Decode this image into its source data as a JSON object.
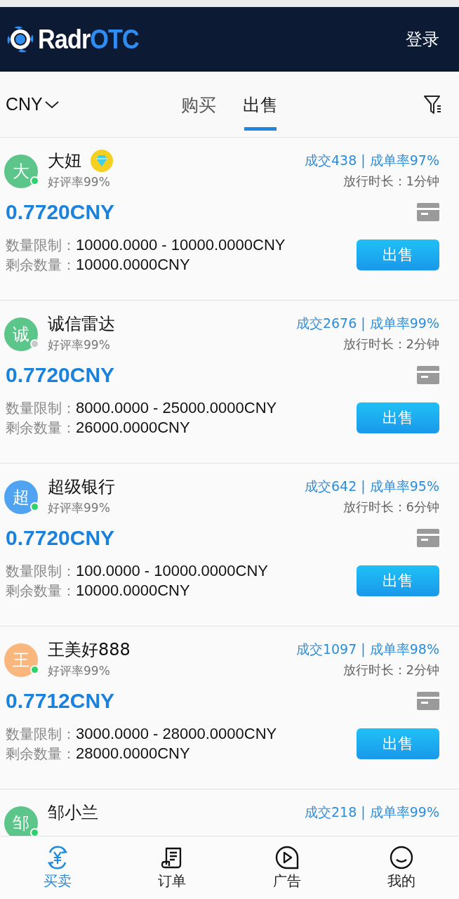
{
  "header": {
    "logo": {
      "part_1": "Radr",
      "part_2": "OTC"
    },
    "login": "登录"
  },
  "toolbar": {
    "currency": "CNY",
    "tabs": [
      {
        "label": "购买",
        "selected": false
      },
      {
        "label": "出售",
        "selected": true
      }
    ]
  },
  "listings": [
    {
      "avatar": "大",
      "color": "#5cc58a",
      "online": true,
      "vip": true,
      "name": "大妞",
      "rating": "好评率99%",
      "stats": "成交438 | 成单率97%",
      "release_time": "放行时长：1分钟",
      "price": "0.7720CNY",
      "limit_label": "数量限制：",
      "limit": "10000.0000 - 10000.0000CNY",
      "remaining_label": "剩余数量：",
      "remaining": "10000.0000CNY",
      "button": "出售"
    },
    {
      "avatar": "诚",
      "color": "#5cc58a",
      "online": false,
      "vip": false,
      "name": "诚信雷达",
      "rating": "好评率99%",
      "stats": "成交2676 | 成单率99%",
      "release_time": "放行时长：2分钟",
      "price": "0.7720CNY",
      "limit_label": "数量限制：",
      "limit": "8000.0000 - 25000.0000CNY",
      "remaining_label": "剩余数量：",
      "remaining": "26000.0000CNY",
      "button": "出售"
    },
    {
      "avatar": "超",
      "color": "#4fa3f0",
      "online": true,
      "vip": false,
      "name": "超级银行",
      "rating": "好评率99%",
      "stats": "成交642 | 成单率95%",
      "release_time": "放行时长：6分钟",
      "price": "0.7720CNY",
      "limit_label": "数量限制：",
      "limit": "100.0000 - 10000.0000CNY",
      "remaining_label": "剩余数量：",
      "remaining": "10000.0000CNY",
      "button": "出售"
    },
    {
      "avatar": "王",
      "color": "#f9b77e",
      "online": true,
      "vip": false,
      "name": "王美好888",
      "rating": "好评率99%",
      "stats": "成交1097 | 成单率98%",
      "release_time": "放行时长：2分钟",
      "price": "0.7712CNY",
      "limit_label": "数量限制：",
      "limit": "3000.0000 - 28000.0000CNY",
      "remaining_label": "剩余数量：",
      "remaining": "28000.0000CNY",
      "button": "出售"
    },
    {
      "avatar": "邹",
      "color": "#5cc58a",
      "online": true,
      "vip": false,
      "name": "邹小兰",
      "stats": "成交218 | 成单率99%"
    }
  ],
  "bottom_nav": [
    {
      "kind": "trade",
      "label": "买卖",
      "selected": true
    },
    {
      "kind": "orders",
      "label": "订单",
      "selected": false
    },
    {
      "kind": "ads",
      "label": "广告",
      "selected": false
    },
    {
      "kind": "me",
      "label": "我的",
      "selected": false
    }
  ]
}
